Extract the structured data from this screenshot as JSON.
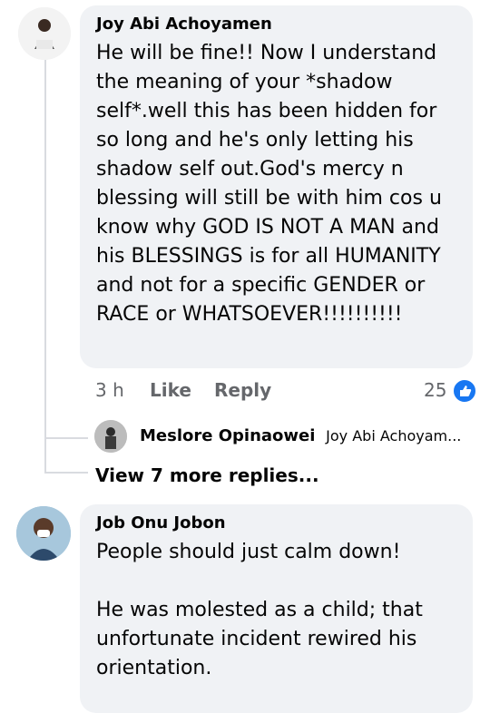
{
  "comments": [
    {
      "author": "Joy Abi Achoyamen",
      "text": "He will be fine!! Now I understand the meaning of your  *shadow self*.well this has been hidden for so long and he's only letting his shadow self out.God's mercy n blessing will still be with him cos u know why GOD IS NOT A MAN and his BLESSINGS is for all HUMANITY and not  for a specific GENDER or RACE or WHATSOEVER!!!!!!!!!!",
      "time": "3 h",
      "like_label": "Like",
      "reply_label": "Reply",
      "reaction_count": "25",
      "reaction_icon": "like-icon",
      "reply_preview": {
        "author": "Meslore Opinaowei",
        "text": "Joy Abi Achoyam..."
      },
      "more_replies": "View 7 more replies..."
    },
    {
      "author": "Job Onu Jobon",
      "text": "People should just calm down!\n\nHe was molested as a child; that unfortunate incident rewired his orientation."
    }
  ],
  "colors": {
    "bubble": "#f0f2f5",
    "meta": "#65676b",
    "like": "#1877f2"
  }
}
